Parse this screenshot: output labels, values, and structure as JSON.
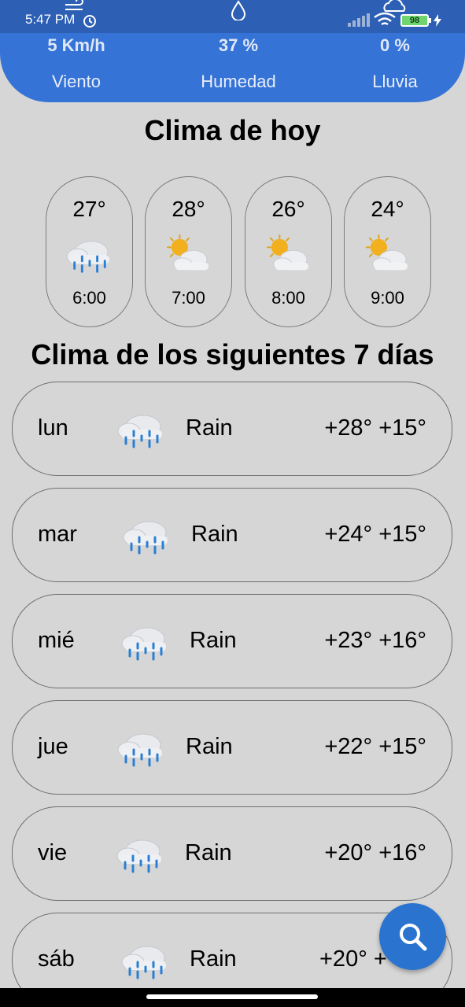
{
  "status_bar": {
    "time": "5:47 PM",
    "battery": "98"
  },
  "summary": {
    "wind": {
      "value": "5 Km/h",
      "label": "Viento"
    },
    "humidity": {
      "value": "37 %",
      "label": "Humedad"
    },
    "rain": {
      "value": "0 %",
      "label": "Lluvia"
    }
  },
  "today": {
    "title": "Clima de hoy",
    "hours": [
      {
        "temp": "27°",
        "icon": "rain-cloud-icon",
        "time": "6:00"
      },
      {
        "temp": "28°",
        "icon": "partly-cloudy-icon",
        "time": "7:00"
      },
      {
        "temp": "26°",
        "icon": "partly-cloudy-icon",
        "time": "8:00"
      },
      {
        "temp": "24°",
        "icon": "partly-cloudy-icon",
        "time": "9:00"
      }
    ]
  },
  "week": {
    "title": "Clima de los siguientes 7 días",
    "days": [
      {
        "day": "lun",
        "desc": "Rain",
        "temps": "+28° +15°"
      },
      {
        "day": "mar",
        "desc": "Rain",
        "temps": "+24° +15°"
      },
      {
        "day": "mié",
        "desc": "Rain",
        "temps": "+23° +16°"
      },
      {
        "day": "jue",
        "desc": "Rain",
        "temps": "+22° +15°"
      },
      {
        "day": "vie",
        "desc": "Rain",
        "temps": "+20° +16°"
      },
      {
        "day": "sáb",
        "desc": "Rain",
        "temps": "+20° +"
      }
    ]
  },
  "colors": {
    "header_blue": "#3673d6",
    "fab_blue": "#2a73cf",
    "background": "#d6d6d6"
  }
}
